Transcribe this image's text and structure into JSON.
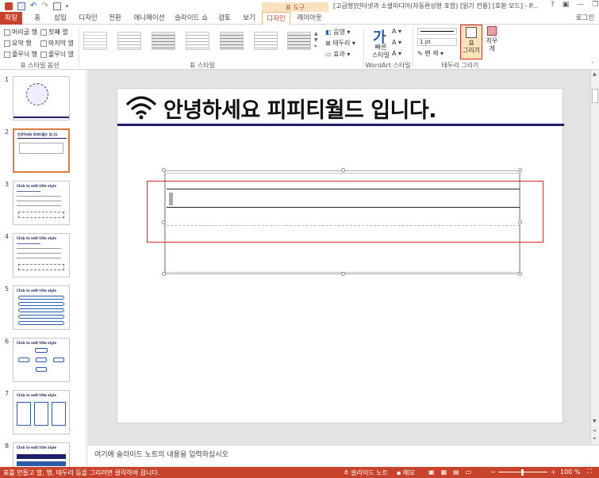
{
  "window": {
    "title": "[고급형]인터넷과 소셜미디어(자동완성형 포함) [읽기 전용] [호환 모드] - P...",
    "context_band": "표 도구",
    "signin": "로그인"
  },
  "tabs": [
    "파일",
    "홈",
    "삽입",
    "디자인",
    "전환",
    "애니메이션",
    "슬라이드 쇼",
    "검토",
    "보기",
    "디자인",
    "레이아웃"
  ],
  "ribbon": {
    "style_options": {
      "items": [
        "머리글 행",
        "첫째 열",
        "요약 행",
        "마지막 열",
        "줄무늬 행",
        "줄무늬 열"
      ],
      "label": "표 스타일 옵션"
    },
    "table_styles": {
      "label": "표 스타일"
    },
    "shading": {
      "fill_label": "음영",
      "border_label": "테두리",
      "effect_label": "효과"
    },
    "wordart": {
      "quick_styles_line1": "빠른",
      "quick_styles_line2": "스타일",
      "label": "WordArt 스타일"
    },
    "draw_borders": {
      "pen_weight": "1 pt",
      "pen_color": "펜 색",
      "draw_table_line1": "표",
      "draw_table_line2": "그리기",
      "eraser": "지우개",
      "label": "테두리 그리기"
    }
  },
  "thumbnails": [
    {
      "num": "1",
      "title": ""
    },
    {
      "num": "2",
      "title": "안녕하세요 피피티월드 입니다"
    },
    {
      "num": "3",
      "title": "Click to edit title style"
    },
    {
      "num": "4",
      "title": "Click to edit title style"
    },
    {
      "num": "5",
      "title": "Click to edit title style"
    },
    {
      "num": "6",
      "title": "Click to edit title style"
    },
    {
      "num": "7",
      "title": "Click to edit title style"
    },
    {
      "num": "8",
      "title": "Click to edit title style"
    }
  ],
  "slide": {
    "title": "안녕하세요 피피티월드 입니다."
  },
  "notes": {
    "placeholder": "여기에 슬라이드 노트의 내용을 입력하십시오"
  },
  "status": {
    "message": "표를 만들고 열, 행, 테두리 등을 그리려면 클릭하여 끕니다.",
    "notes_btn": "슬라이드 노트",
    "memo_btn": "메모",
    "zoom": "100 %"
  },
  "colors": {
    "accent": "#c8432b",
    "title_rule": "#1d1f6b",
    "highlight": "#d8282a"
  }
}
